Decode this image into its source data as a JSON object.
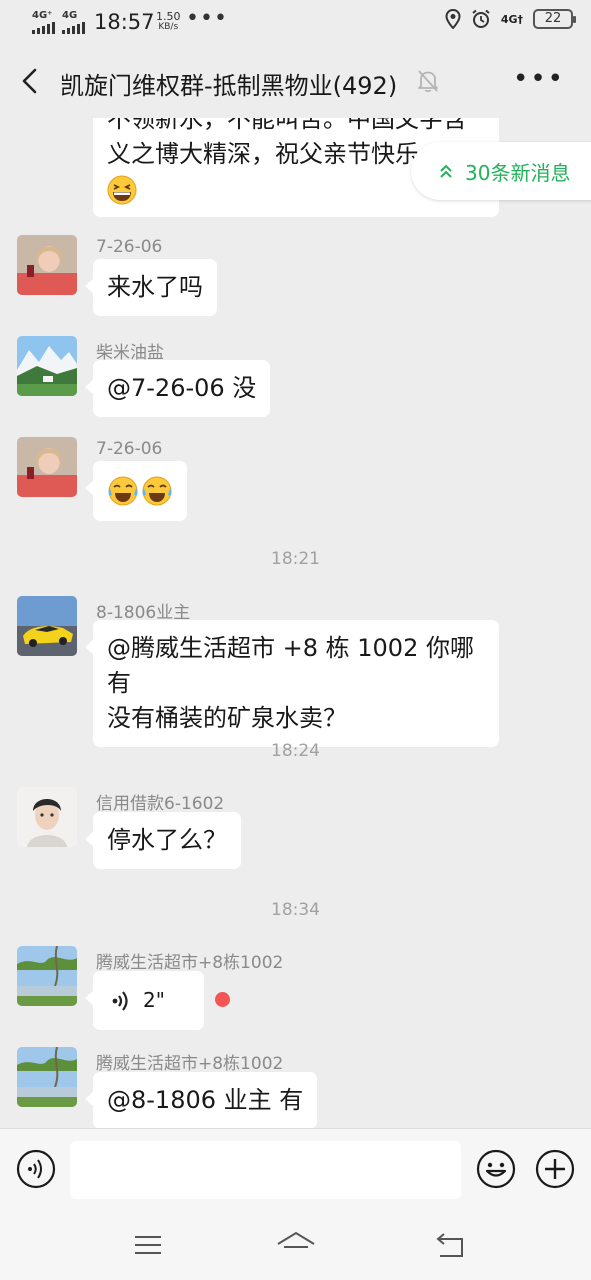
{
  "status_bar": {
    "signal_1": "4G⁺",
    "signal_2": "4G",
    "time": "18:57",
    "speed_value": "1.50",
    "speed_unit": "KB/s",
    "more_dots": "•••",
    "network_right": "4G†",
    "battery": "22"
  },
  "header": {
    "title": "凯旋门维权群-抵制黑物业(492)",
    "more": "•••"
  },
  "new_messages": {
    "label": "30条新消息"
  },
  "messages": [
    {
      "partial_text_line1": "不领新水，不能叫苦。中国文字含",
      "partial_text_line2": "义之博大精深，祝父亲节快乐",
      "emoji": "grin-squint-emoji"
    },
    {
      "sender": "7-26-06",
      "text": "来水了吗"
    },
    {
      "sender": "柴米油盐",
      "text": "@7-26-06  没"
    },
    {
      "sender": "7-26-06",
      "emoji": "crying-laughing-emoji x2"
    },
    {
      "timestamp": "18:21"
    },
    {
      "sender": "8-1806业主",
      "text_line1": "@腾威生活超市 +8 栋 1002  你哪有",
      "text_line2": "没有桶装的矿泉水卖？"
    },
    {
      "timestamp": "18:24"
    },
    {
      "sender": "信用借款6-1602",
      "text": "停水了么？"
    },
    {
      "timestamp": "18:34"
    },
    {
      "sender": "腾威生活超市+8栋1002",
      "voice_duration": "2\"",
      "unread": true
    },
    {
      "sender": "腾威生活超市+8栋1002",
      "text": "@8-1806 业主  有"
    }
  ],
  "colors": {
    "background": "#ededed",
    "bubble": "#ffffff",
    "accent_green": "#23b25a",
    "unread_dot": "#f35454"
  }
}
